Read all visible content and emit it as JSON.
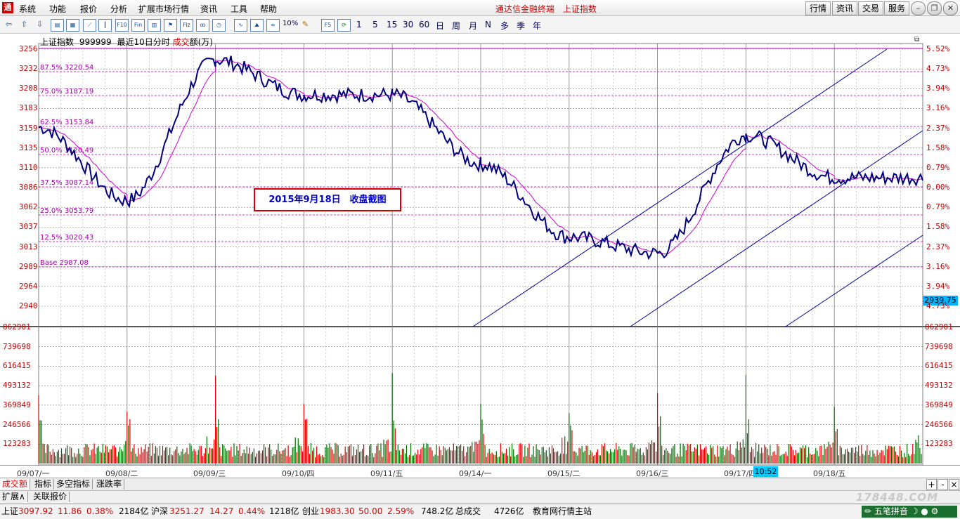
{
  "menu": {
    "items": [
      "系统",
      "功能",
      "报价",
      "分析",
      "扩展市场行情",
      "资讯",
      "工具",
      "帮助"
    ],
    "app_title": "通达信金融终端",
    "index_title": "上证指数",
    "right_buttons": [
      "行情",
      "资讯",
      "交易",
      "服务"
    ]
  },
  "toolbar": {
    "icons": [
      "back-arrow-icon",
      "up-arrow-icon",
      "down-arrow-icon",
      "page-icon",
      "grid-icon",
      "line-chart-icon",
      "candle-icon",
      "F10-icon",
      "Fin-icon",
      "book-icon",
      "flag-icon",
      "Fiz-icon",
      "pattern-icon",
      "clock-icon",
      "trend-icon",
      "mountain-icon",
      "wave-icon",
      "pencil-icon"
    ],
    "pct_label": "10%",
    "f5_label": "F5",
    "periods": [
      "1",
      "5",
      "15",
      "30",
      "60",
      "日",
      "周",
      "月",
      "N",
      "多",
      "季",
      "年"
    ]
  },
  "chart": {
    "header_name": "上证指数",
    "header_code": "999999",
    "header_range": "最近10日分时",
    "header_vol_prefix": "成交",
    "header_vol_suffix": "额(万)",
    "annotation": "2015年9月18日　收盘截图",
    "current_price_tag": "2939.75",
    "time_cursor": "10:52",
    "price_labels": [
      "3256",
      "3232",
      "3208",
      "3183",
      "3159",
      "3135",
      "3110",
      "3086",
      "3062",
      "3037",
      "3013",
      "2989",
      "2964",
      "2940"
    ],
    "pct_labels": [
      "5.52%",
      "4.73%",
      "3.94%",
      "3.16%",
      "2.37%",
      "1.58%",
      "0.79%",
      "0.00%",
      "0.79%",
      "1.58%",
      "2.37%",
      "3.16%",
      "3.94%",
      "4.73%"
    ],
    "volume_labels": [
      "862981",
      "739698",
      "616415",
      "493132",
      "369849",
      "246566",
      "123283"
    ],
    "fib_labels": [
      "87.5% 3220.54",
      "75.0% 3187.19",
      "62.5% 3153.84",
      "50.0% 3120.49",
      "37.5% 3087.14",
      "25.0% 3053.79",
      "12.5% 3020.43",
      "Base 2987.08"
    ],
    "x_labels": [
      "09/07/一",
      "09/08/二",
      "09/09/三",
      "09/10/四",
      "09/11/五",
      "09/14/一",
      "09/15/二",
      "09/16/三",
      "09/17/四",
      "09/18/五"
    ]
  },
  "colors": {
    "background": "#ffffff",
    "price_line": "#00007a",
    "avg_line": "#d000d0",
    "grid": "#7f7f7f",
    "axis_text": "#c00000",
    "vol_up": "#e00000",
    "vol_down": "#007000",
    "channel": "#0000a0"
  },
  "chart_data": {
    "type": "line",
    "title": "上证指数 999999 最近10日分时",
    "x": [
      "09/07",
      "09/08",
      "09/09",
      "09/10",
      "09/11",
      "09/14",
      "09/15",
      "09/16",
      "09/17",
      "09/18"
    ],
    "series": [
      {
        "name": "上证指数",
        "values": [
          3160,
          3070,
          3243,
          3200,
          3200,
          3115,
          3025,
          3005,
          3150,
          3097.92
        ]
      }
    ],
    "ylim": [
      2940,
      3256
    ],
    "volume_ylim": [
      0,
      862981
    ]
  },
  "bottom_tabs": {
    "row1": [
      "成交额",
      "指标",
      "多空指标",
      "涨跌率"
    ],
    "row2": [
      "扩展∧",
      "关联报价"
    ],
    "right_ctrls": [
      "+",
      "-",
      "×"
    ]
  },
  "status": {
    "sh_label": "上证",
    "sh_price": "3097.92",
    "sh_change": "11.86",
    "sh_pct": "0.38%",
    "sh_vol": "2184亿",
    "sz_label": "沪深",
    "sz_price": "3251.27",
    "sz_change": "14.27",
    "sz_pct": "0.44%",
    "sz_vol": "1218亿",
    "cy_label": "创业",
    "cy_price": "1983.30",
    "cy_change": "50.00",
    "cy_pct": "2.59%",
    "cy_vol": "748.2亿",
    "total_label": "总成交",
    "total_vol": "4726亿",
    "site": "教育网行情主站",
    "ime": "五笔拼音"
  },
  "watermark": "178448.COM"
}
